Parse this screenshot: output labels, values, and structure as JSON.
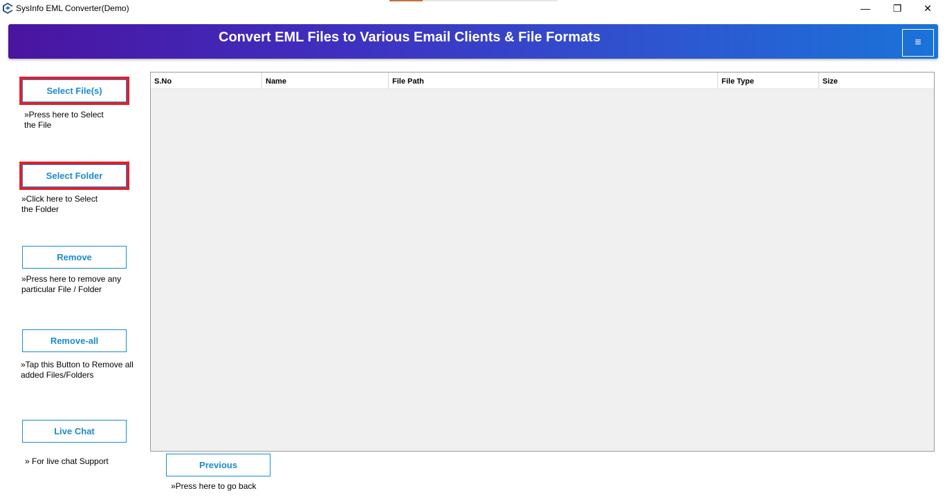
{
  "window": {
    "title": "SysInfo EML Converter(Demo)",
    "min_glyph": "—",
    "max_glyph": "❐",
    "close_glyph": "✕"
  },
  "banner": {
    "title": "Convert EML Files to Various Email Clients & File Formats",
    "menu_glyph": "≡"
  },
  "sidebar": {
    "select_files": {
      "label": "Select File(s)",
      "hint": "»Press here to Select the File"
    },
    "select_folder": {
      "label": "Select Folder",
      "hint": "»Click here to Select the Folder"
    },
    "remove": {
      "label": "Remove",
      "hint": "»Press here to remove any particular File / Folder"
    },
    "remove_all": {
      "label": "Remove-all",
      "hint": "»Tap this Button to Remove all added Files/Folders"
    },
    "live_chat": {
      "label": "Live Chat",
      "hint": "» For live chat Support"
    }
  },
  "table": {
    "columns": [
      "S.No",
      "Name",
      "File Path",
      "File Type",
      "Size"
    ],
    "rows": []
  },
  "footer": {
    "previous_label": "Previous",
    "previous_hint": "»Press here to go back"
  },
  "colors": {
    "accent": "#1a8ad4",
    "highlight": "#e0202e",
    "banner_start": "#4a14a0",
    "banner_end": "#1a73d8"
  }
}
